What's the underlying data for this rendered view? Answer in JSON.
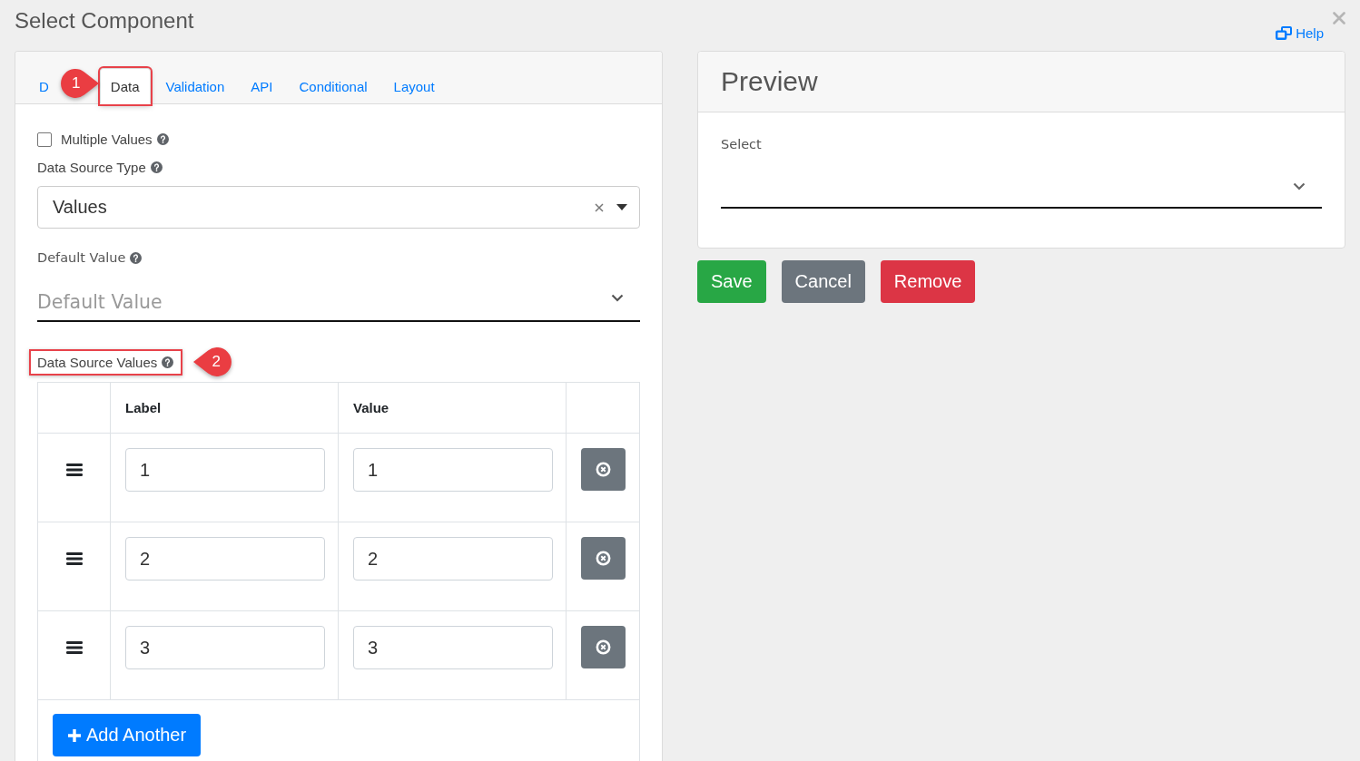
{
  "dialog": {
    "title": "Select Component",
    "help_link": "Help"
  },
  "tabs": [
    {
      "label": "D",
      "selected": false,
      "highlighted": false
    },
    {
      "label": "Data",
      "selected": true,
      "highlighted": true,
      "callout": "1"
    },
    {
      "label": "Validation",
      "selected": false,
      "highlighted": false
    },
    {
      "label": "API",
      "selected": false,
      "highlighted": false
    },
    {
      "label": "Conditional",
      "selected": false,
      "highlighted": false
    },
    {
      "label": "Layout",
      "selected": false,
      "highlighted": false
    }
  ],
  "multiple_values": {
    "label": "Multiple Values",
    "checked": false
  },
  "data_source_type": {
    "label": "Data Source Type",
    "value": "Values"
  },
  "default_value": {
    "label": "Default Value",
    "placeholder": "Default Value"
  },
  "data_source_values": {
    "label": "Data Source Values",
    "highlighted": true,
    "callout": "2",
    "columns": [
      "Label",
      "Value"
    ],
    "rows": [
      {
        "label": "1",
        "value": "1"
      },
      {
        "label": "2",
        "value": "2"
      },
      {
        "label": "3",
        "value": "3"
      }
    ],
    "add_button": "Add Another"
  },
  "preview": {
    "title": "Preview",
    "select_label": "Select"
  },
  "buttons": [
    {
      "label": "Save",
      "kind": "success"
    },
    {
      "label": "Cancel",
      "kind": "secondary"
    },
    {
      "label": "Remove",
      "kind": "danger"
    }
  ]
}
